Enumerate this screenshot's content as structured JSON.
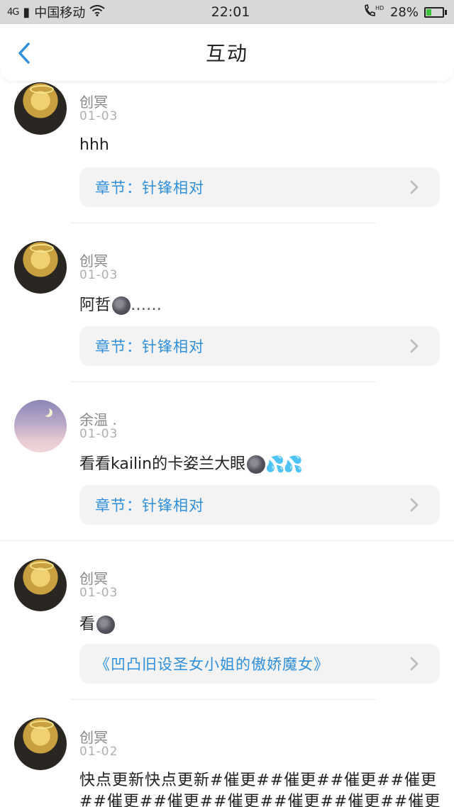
{
  "status_bar": {
    "network": "4G",
    "carrier": "中国移动",
    "time": "22:01",
    "hd": "HD",
    "battery": "28%",
    "battery_level": 0.28,
    "battery_color": "#3cc23c"
  },
  "header": {
    "title": "互动",
    "back_icon": "chevron-left-icon",
    "accent": "#2f8fdc"
  },
  "comments": [
    {
      "user": "创冥",
      "date": "01-03",
      "avatar": "blonde-girl-avatar",
      "text": "hhh",
      "emoji_after": "",
      "link": "章节：针锋相对"
    },
    {
      "user": "创冥",
      "date": "01-03",
      "avatar": "blonde-girl-avatar",
      "text": "阿哲",
      "emoji_after": "new-moon-face-emoji",
      "trailing_text": "……",
      "link": "章节：针锋相对"
    },
    {
      "user": "余温 .",
      "date": "01-03",
      "avatar": "night-sky-avatar",
      "text": "看看kailin的卡姿兰大眼",
      "emoji_after": "new-moon-face-emoji",
      "trailing_emoji": "sweat-droplets-emoji",
      "link": "章节：针锋相对"
    },
    {
      "user": "创冥",
      "date": "01-03",
      "avatar": "blonde-girl-avatar",
      "text": "看",
      "emoji_after": "new-moon-face-emoji",
      "link": "《凹凸旧设圣女小姐的傲娇魔女》"
    },
    {
      "user": "创冥",
      "date": "01-02",
      "avatar": "blonde-girl-avatar",
      "text": "快点更新快点更新#催更##催更##催更##催更##催更##催更##催更##催更##催更##催更##"
    }
  ]
}
